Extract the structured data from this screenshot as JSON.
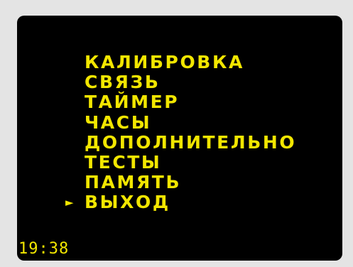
{
  "menu": {
    "items": [
      {
        "label": "КАЛИБРОВКА",
        "selected": false
      },
      {
        "label": "СВЯЗЬ",
        "selected": false
      },
      {
        "label": "ТАЙМЕР",
        "selected": false
      },
      {
        "label": "ЧАСЫ",
        "selected": false
      },
      {
        "label": "ДОПОЛНИТЕЛЬНО",
        "selected": false
      },
      {
        "label": "ТЕСТЫ",
        "selected": false
      },
      {
        "label": "ПАМЯТЬ",
        "selected": false
      },
      {
        "label": "ВЫХОД",
        "selected": true
      }
    ],
    "cursor_glyph": "►"
  },
  "status": {
    "time": "19:38"
  },
  "colors": {
    "background": "#000000",
    "text": "#f2e600",
    "bezel": "#e4e4e4"
  }
}
